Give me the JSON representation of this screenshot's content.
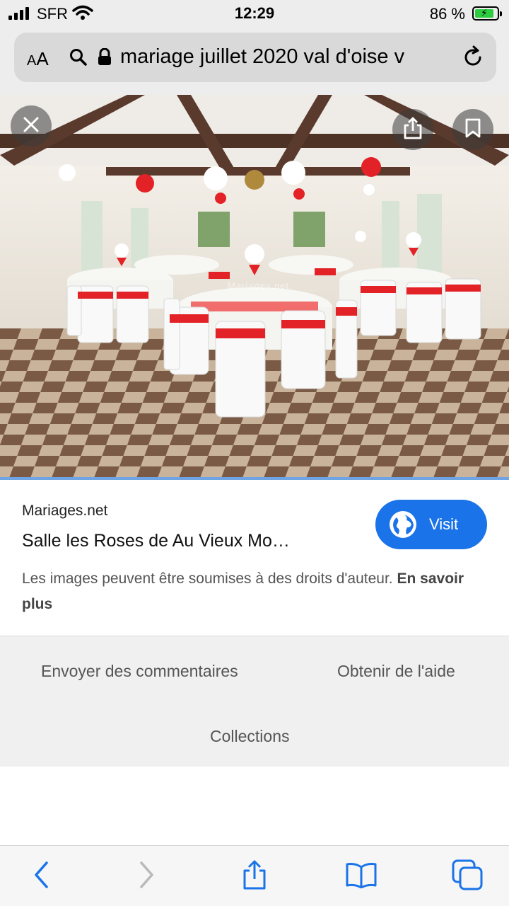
{
  "status_bar": {
    "carrier": "SFR",
    "time": "12:29",
    "battery_percent": "86 %",
    "battery_level": 0.86
  },
  "address_bar": {
    "text_size_label": "AA",
    "url": "mariage juillet 2020 val d'oise v"
  },
  "image_viewer": {
    "watermark": "Mariages.net"
  },
  "result": {
    "source": "Mariages.net",
    "title": "Salle les Roses de Au Vieux Mo…",
    "visit_label": "Visit",
    "rights_text": "Les images peuvent être soumises à des droits d'auteur.",
    "learn_more": "En savoir plus"
  },
  "footer": {
    "feedback": "Envoyer des commentaires",
    "help": "Obtenir de l'aide",
    "collections": "Collections"
  },
  "colors": {
    "accent": "#1a73e8",
    "toolbar_icon": "#1a73e8",
    "disabled_icon": "#b9b9b9"
  },
  "icons": [
    "close-icon",
    "share-icon",
    "bookmark-icon",
    "search-icon",
    "lock-icon",
    "reload-icon",
    "globe-icon",
    "back-icon",
    "forward-icon",
    "book-icon",
    "tabs-icon"
  ]
}
